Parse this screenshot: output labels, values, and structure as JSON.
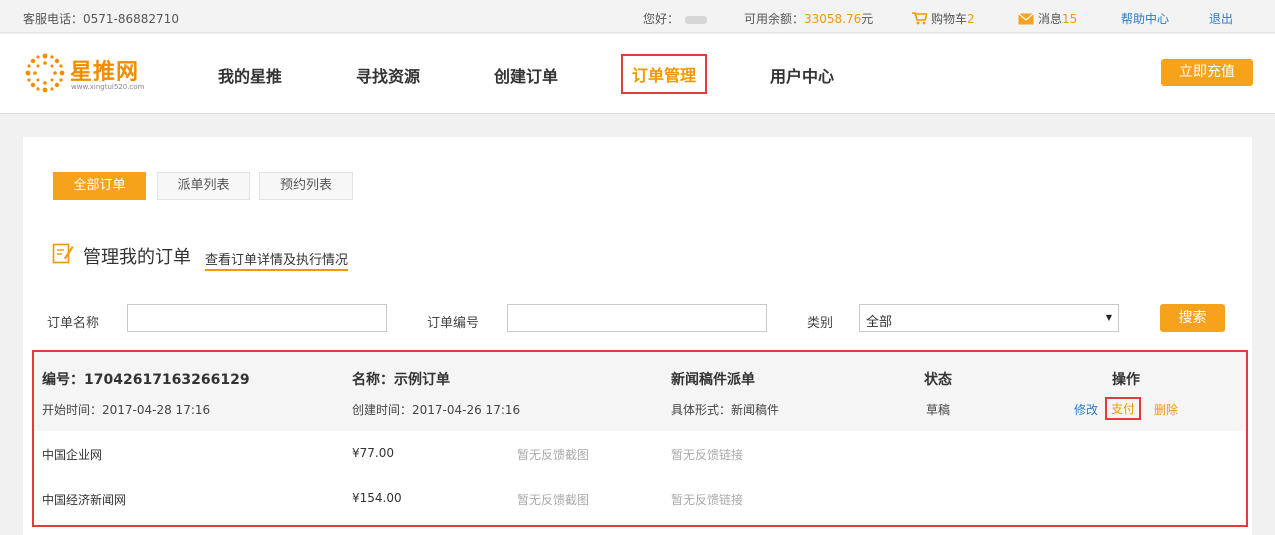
{
  "topbar": {
    "hotline": "客服电话：0571-86882710",
    "greeting": "您好：",
    "balance_label": "可用余额：",
    "balance_amount": "33058.76",
    "balance_unit": "元",
    "cart_label": "购物车",
    "cart_count": "2",
    "msg_label": "消息",
    "msg_count": "15",
    "help": "帮助中心",
    "logout": "退出"
  },
  "header": {
    "logo_text": "星推网",
    "logo_url": "www.xingtui520.com",
    "nav": [
      "我的星推",
      "寻找资源",
      "创建订单",
      "订单管理",
      "用户中心"
    ],
    "active_nav": "订单管理",
    "recharge": "立即充值"
  },
  "tabs": [
    "全部订单",
    "派单列表",
    "预约列表"
  ],
  "section": {
    "title": "管理我的订单",
    "subtitle": "查看订单详情及执行情况"
  },
  "filters": {
    "name_label": "订单名称",
    "name_value": "",
    "number_label": "订单编号",
    "number_value": "",
    "category_label": "类别",
    "category_value": "全部",
    "search": "搜索"
  },
  "order": {
    "number": "编号：17042617163266129",
    "name": "名称：示例订单",
    "type": "新闻稿件派单",
    "status_label": "状态",
    "ops_label": "操作",
    "start_time": "开始时间：2017-04-28 17:16",
    "create_time": "创建时间：2017-04-26 17:16",
    "form": "具体形式：新闻稿件",
    "status": "草稿",
    "edit": "修改",
    "pay": "支付",
    "delete": "删除",
    "rows": [
      {
        "site": "中国企业网",
        "price": "¥77.00",
        "screenshot": "暂无反馈截图",
        "link": "暂无反馈链接"
      },
      {
        "site": "中国经济新闻网",
        "price": "¥154.00",
        "screenshot": "暂无反馈截图",
        "link": "暂无反馈链接"
      }
    ]
  },
  "colors": {
    "accent": "#f7a21b",
    "highlight": "#e23b3b",
    "link": "#2c7bc7"
  },
  "icons": [
    "cart-icon",
    "mail-icon",
    "edit-note-icon",
    "logo-burst-icon"
  ]
}
